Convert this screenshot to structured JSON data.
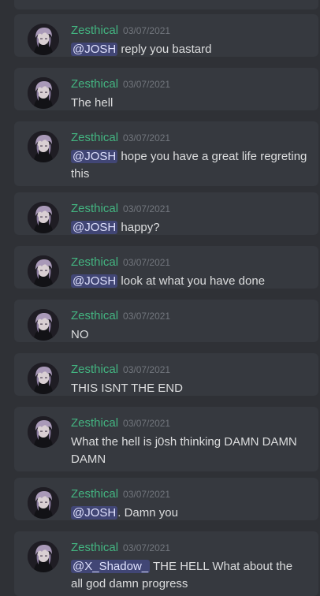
{
  "messages": [
    {
      "author": "Zesthical",
      "date": "03/07/2021",
      "mention": "@JOSH",
      "text": " reply you bastard"
    },
    {
      "author": "Zesthical",
      "date": "03/07/2021",
      "mention": "",
      "text": "The hell"
    },
    {
      "author": "Zesthical",
      "date": "03/07/2021",
      "mention": "@JOSH",
      "text": " hope you have a great life regreting this"
    },
    {
      "author": "Zesthical",
      "date": "03/07/2021",
      "mention": "@JOSH",
      "text": " happy?"
    },
    {
      "author": "Zesthical",
      "date": "03/07/2021",
      "mention": "@JOSH",
      "text": " look at what you have done"
    },
    {
      "author": "Zesthical",
      "date": "03/07/2021",
      "mention": "",
      "text": "NO"
    },
    {
      "author": "Zesthical",
      "date": "03/07/2021",
      "mention": "",
      "text": "THIS ISNT THE END"
    },
    {
      "author": "Zesthical",
      "date": "03/07/2021",
      "mention": "",
      "text": "What the hell is j0sh thinking DAMN DAMN DAMN"
    },
    {
      "author": "Zesthical",
      "date": "03/07/2021",
      "mention": "@JOSH",
      "text": ". Damn you"
    },
    {
      "author": "Zesthical",
      "date": "03/07/2021",
      "mention": "@X_Shadow_",
      "text": " THE HELL What about the all god damn progress"
    }
  ],
  "colors": {
    "background": "#2f3136",
    "card": "#36393f",
    "author": "#43b581",
    "text": "#dcddde",
    "timestamp": "#72767d",
    "mention_bg": "#414675",
    "mention_text": "#dee0fc"
  },
  "avatar_icon": "avatar-icon"
}
